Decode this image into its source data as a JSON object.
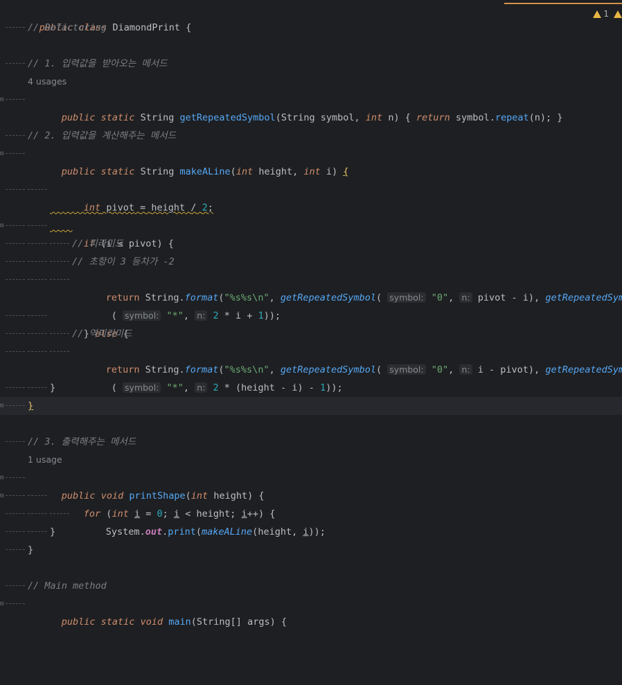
{
  "editor": {
    "inspections": {
      "warning_count": "1"
    },
    "lines": {
      "l1": {
        "class_kw": "public class",
        "class_name": "DiamondPrint",
        "brace": " {"
      },
      "l2": {
        "comment": "// Refactoring"
      },
      "l4": {
        "comment": "// 1. 입력값을 받아오는 메서드"
      },
      "l5": {
        "usages": "4 usages"
      },
      "l6": {
        "mods": "public static",
        "type": "String",
        "name": "getRepeatedSymbol",
        "p1type": "String",
        "p1": "symbol",
        "p2type": "int",
        "p2": "n",
        "ret": "return",
        "call_obj": "symbol",
        "call": "repeat",
        "arg": "n",
        "tail": "); }"
      },
      "l8": {
        "comment": "// 2. 입력값을 계산해주는 메서드"
      },
      "l9": {
        "mods": "public static",
        "type": "String",
        "name": "makeALine",
        "p1type": "int",
        "p1": "height",
        "p2type": "int",
        "p2": "i",
        "brace": "{"
      },
      "l11": {
        "type": "int",
        "var": "pivot",
        "eq": "=",
        "rhs": "height",
        "op": "/",
        "num": "2",
        "semi": ";"
      },
      "l13": {
        "kw": "if",
        "cond_a": "i",
        "cond_op": "≤",
        "cond_b": "pivot",
        "tail": ") {"
      },
      "l14": {
        "comment": "// 피라미드"
      },
      "l15": {
        "comment": "// 초항이 3 등차가 -2"
      },
      "l16": {
        "ret": "return",
        "cls": "String",
        "fmt": "format",
        "str": "\"%s%s\\n\"",
        "fn1": "getRepeatedSymbol",
        "h1": "symbol:",
        "s1": "\"0\"",
        "h2": "n:",
        "e1": "pivot",
        "e1op": "-",
        "e1b": "i",
        "fn2": "getRepeatedSymbol"
      },
      "l17": {
        "h1": "symbol:",
        "s1": "\"*\"",
        "h2": "n:",
        "n1": "2",
        "o1": "*",
        "v1": "i",
        "o2": "+",
        "n2": "1",
        "tail": "));"
      },
      "l18": {
        "close": "}",
        "kw": "else",
        "brace": "{"
      },
      "l19": {
        "comment": "// 역피라미드"
      },
      "l20": {
        "ret": "return",
        "cls": "String",
        "fmt": "format",
        "str": "\"%s%s\\n\"",
        "fn1": "getRepeatedSymbol",
        "h1": "symbol:",
        "s1": "\"0\"",
        "h2": "n:",
        "e1": "i",
        "e1op": "-",
        "e1b": "pivot",
        "fn2": "getRepeatedSymbol"
      },
      "l21": {
        "h1": "symbol:",
        "s1": "\"*\"",
        "h2": "n:",
        "n1": "2",
        "o1": "*",
        "v1": "height",
        "o2": "-",
        "v2": "i",
        "o3": "-",
        "n2": "1",
        "tail": "));"
      },
      "l22": {
        "close": "}"
      },
      "l23": {
        "close": "}"
      },
      "l25": {
        "comment": "// 3. 출력해주는 메서드"
      },
      "l26": {
        "usages": "1 usage"
      },
      "l27": {
        "mods": "public",
        "ret": "void",
        "name": "printShape",
        "p1type": "int",
        "p1": "height",
        "tail": ") {"
      },
      "l28": {
        "kw": "for",
        "t": "int",
        "v": "i",
        "eq": "=",
        "n0": "0",
        "v2": "i",
        "lt": "<",
        "lim": "height",
        "v3": "i",
        "inc": "++",
        "tail": ") {"
      },
      "l29": {
        "cls": "System",
        "fld": "out",
        "fn": "print",
        "call": "makeALine",
        "a1": "height",
        "a2": "i",
        "tail": "));"
      },
      "l30": {
        "close": "}"
      },
      "l31": {
        "close": "}"
      },
      "l33": {
        "comment": "// Main method"
      },
      "l34": {
        "mods": "public static",
        "ret": "void",
        "name": "main",
        "ptype": "String[]",
        "p": "args",
        "tail": ") {"
      }
    }
  }
}
